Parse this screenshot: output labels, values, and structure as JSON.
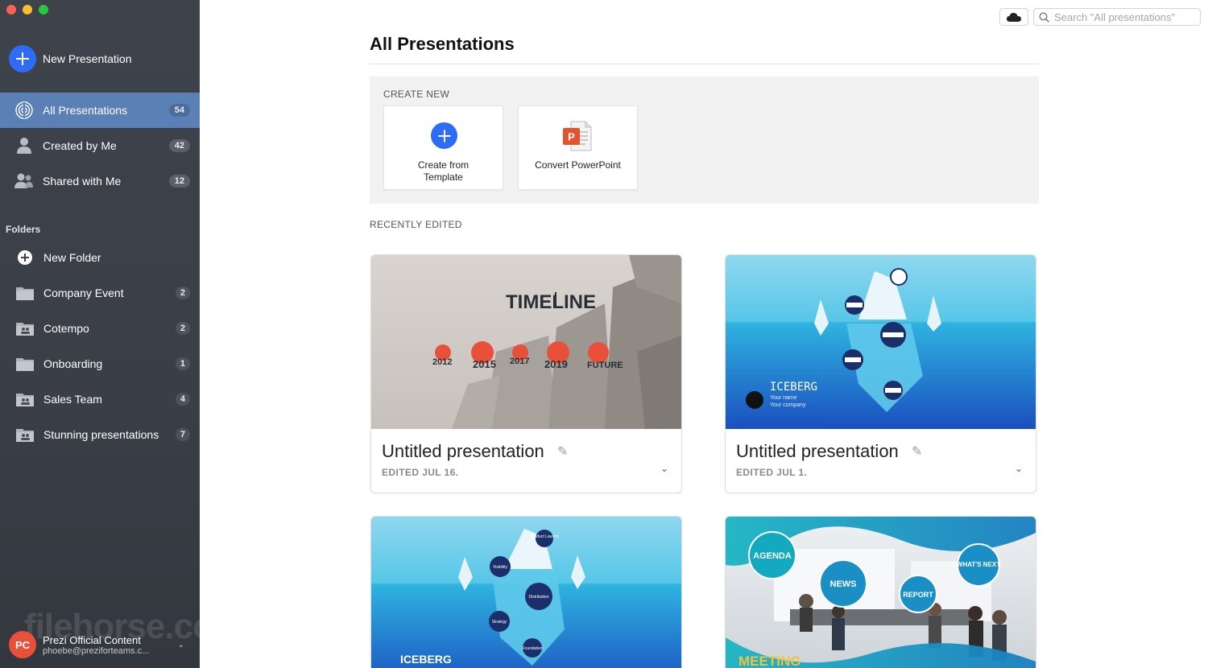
{
  "window": {
    "traffic_lights": [
      "close",
      "minimize",
      "zoom"
    ]
  },
  "sidebar": {
    "new_presentation": "New Presentation",
    "nav": [
      {
        "label": "All Presentations",
        "count": "54",
        "icon": "prezi-logo-icon"
      },
      {
        "label": "Created by Me",
        "count": "42",
        "icon": "user-icon"
      },
      {
        "label": "Shared with Me",
        "count": "12",
        "icon": "users-icon"
      }
    ],
    "folders_title": "Folders",
    "new_folder": "New Folder",
    "folders": [
      {
        "label": "Company Event",
        "count": "2"
      },
      {
        "label": "Cotempo",
        "count": "2"
      },
      {
        "label": "Onboarding",
        "count": "1"
      },
      {
        "label": "Sales Team",
        "count": "4"
      },
      {
        "label": "Stunning presentations",
        "count": "7"
      }
    ],
    "user": {
      "initials": "PC",
      "name": "Prezi Official Content",
      "email": "phoebe@preziforteams.c..."
    },
    "watermark": "filehorse.com"
  },
  "topbar": {
    "search_placeholder": "Search \"All presentations\"",
    "cloud_icon": "cloud-icon"
  },
  "main": {
    "title": "All Presentations",
    "create_new": {
      "title": "CREATE NEW",
      "template_label": "Create from Template",
      "ppt_label": "Convert PowerPoint"
    },
    "recently_edited_title": "RECENTLY EDITED",
    "presentations": [
      {
        "name": "Untitled presentation",
        "edited": "EDITED JUL 16.",
        "thumb": {
          "title": "TIMELINE",
          "years": [
            "2012",
            "2015",
            "2017",
            "2019",
            "FUTURE"
          ]
        }
      },
      {
        "name": "Untitled presentation",
        "edited": "EDITED JUL 1.",
        "thumb": {
          "title": "ICEBERG",
          "line1": "Your name",
          "line2": "Your company"
        }
      },
      {
        "thumb": {
          "title": "ICEBERG",
          "bubbles": [
            "Product Launch",
            "Visibility",
            "Distribution",
            "Strategy",
            "Foundation"
          ]
        }
      },
      {
        "thumb": {
          "title": "MEETING",
          "bubbles": [
            "AGENDA",
            "NEWS",
            "REPORT",
            "WHAT'S NEXT"
          ]
        }
      }
    ]
  },
  "colors": {
    "accent": "#2f6cf6",
    "sidebar_active": "#5a80b6",
    "avatar": "#e8503a",
    "timeline_dot": "#e8503a"
  }
}
